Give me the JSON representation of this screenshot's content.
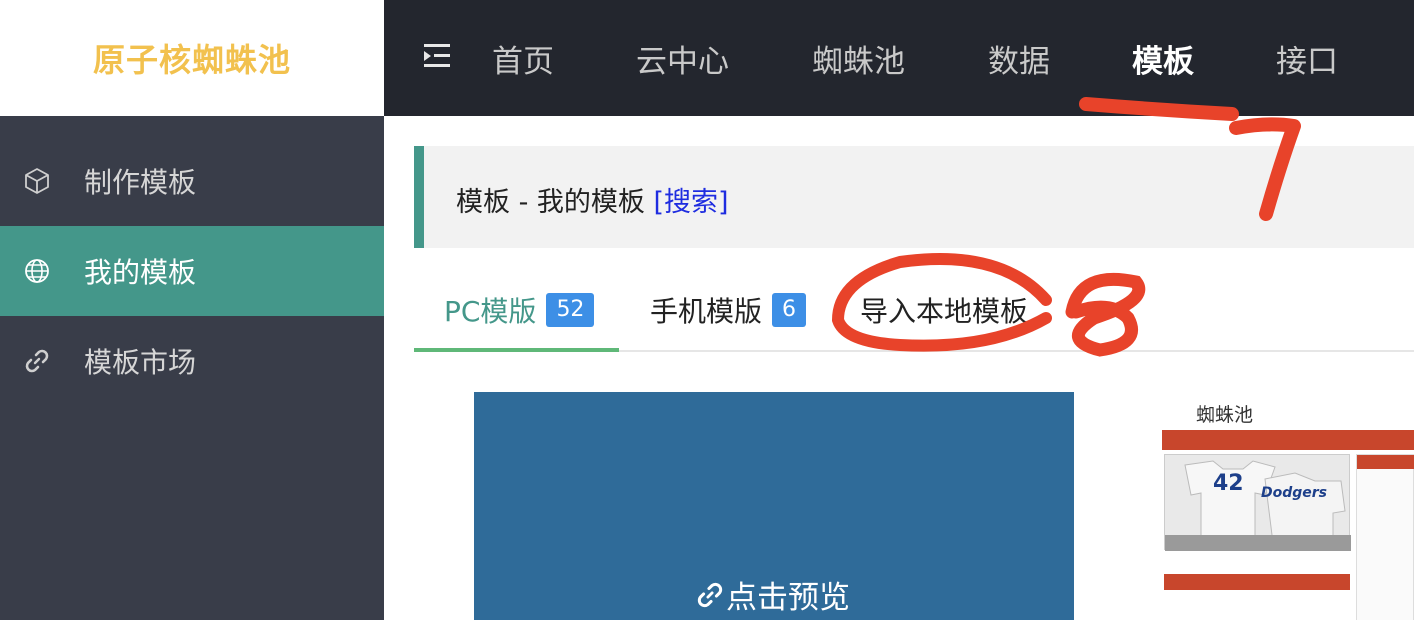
{
  "logo": {
    "text": "原子核蜘蛛池",
    "color": "#f2c14e"
  },
  "topnav": {
    "menu_icon": "indent-menu-icon",
    "items": [
      {
        "label": "首页",
        "active": false
      },
      {
        "label": "云中心",
        "active": false
      },
      {
        "label": "蜘蛛池",
        "active": false
      },
      {
        "label": "数据",
        "active": false
      },
      {
        "label": "模板",
        "active": true
      },
      {
        "label": "接口",
        "active": false
      }
    ]
  },
  "sidebar": {
    "items": [
      {
        "label": "制作模板",
        "icon": "cube-icon",
        "active": false
      },
      {
        "label": "我的模板",
        "icon": "globe-icon",
        "active": true
      },
      {
        "label": "模板市场",
        "icon": "link-icon",
        "active": false
      }
    ],
    "active_color": "#44978a"
  },
  "breadcrumb": {
    "text": "模板 - 我的模板",
    "link": "[搜索]"
  },
  "tabs": [
    {
      "label": "PC模版",
      "badge": "52",
      "active": true
    },
    {
      "label": "手机模版",
      "badge": "6",
      "active": false
    },
    {
      "label": "导入本地模板",
      "badge": null,
      "active": false
    }
  ],
  "cards": [
    {
      "preview_label": "点击预览",
      "icon": "link-icon",
      "color": "#2f6b99"
    },
    {
      "thumb_title": "蜘蛛池",
      "jersey_number": "42",
      "jersey_brand": "Dodgers"
    }
  ],
  "annotations": [
    {
      "mark": "7",
      "color": "#e8432a"
    },
    {
      "mark": "8",
      "color": "#e8432a"
    }
  ]
}
